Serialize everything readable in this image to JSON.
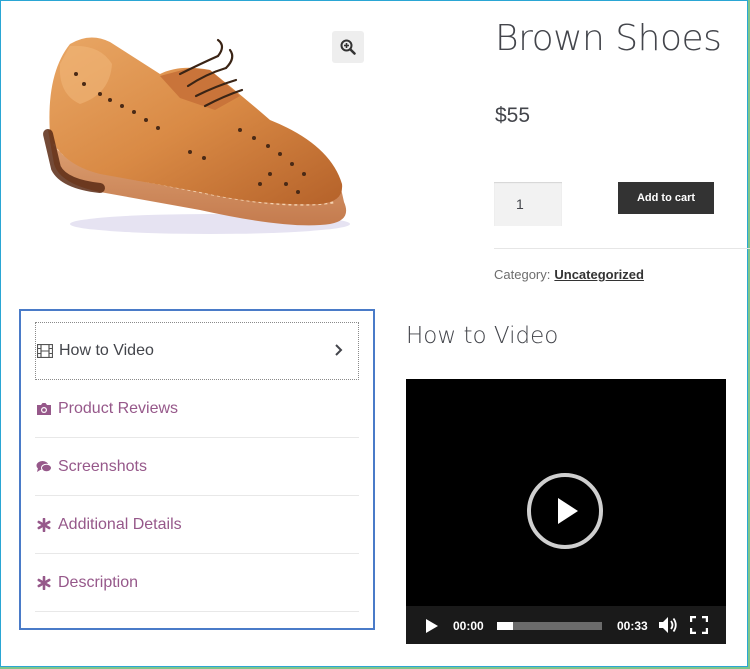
{
  "product": {
    "title": "Brown Shoes",
    "price": "$55",
    "quantity": "1",
    "add_to_cart_label": "Add to cart",
    "category_label": "Category:",
    "category_value": "Uncategorized",
    "image_icon": "brown-brogue-shoe-image",
    "zoom_icon": "zoom-in-icon"
  },
  "tabs": [
    {
      "label": "How to Video",
      "icon": "film-icon",
      "active": true
    },
    {
      "label": "Product Reviews",
      "icon": "camera-icon",
      "active": false
    },
    {
      "label": "Screenshots",
      "icon": "comments-icon",
      "active": false
    },
    {
      "label": "Additional Details",
      "icon": "asterisk-icon",
      "active": false
    },
    {
      "label": "Description",
      "icon": "asterisk-icon",
      "active": false
    }
  ],
  "panel": {
    "title": "How to Video"
  },
  "video": {
    "current_time": "00:00",
    "duration": "00:33",
    "progress_fraction": 0.15
  },
  "colors": {
    "tab_link": "#96588a",
    "button_bg": "#333333",
    "highlight_border": "#4a7bc8"
  }
}
